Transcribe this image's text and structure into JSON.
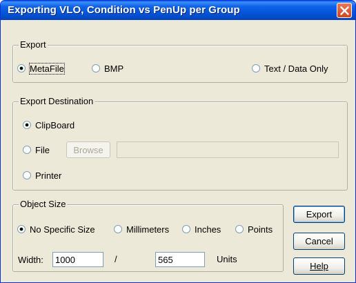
{
  "window": {
    "title": "Exporting VLO, Condition vs PenUp per Group"
  },
  "export": {
    "legend": "Export",
    "options": [
      {
        "label": "MetaFile",
        "checked": true
      },
      {
        "label": "BMP",
        "checked": false
      },
      {
        "label": "Text / Data Only",
        "checked": false
      }
    ]
  },
  "destination": {
    "legend": "Export Destination",
    "clipboard": {
      "label": "ClipBoard",
      "checked": true
    },
    "file": {
      "label": "File",
      "checked": false
    },
    "browse_label": "Browse",
    "file_path": "",
    "printer": {
      "label": "Printer",
      "checked": false
    }
  },
  "object_size": {
    "legend": "Object Size",
    "options": [
      {
        "label": "No Specific Size",
        "checked": true
      },
      {
        "label": "Millimeters",
        "checked": false
      },
      {
        "label": "Inches",
        "checked": false
      },
      {
        "label": "Points",
        "checked": false
      }
    ],
    "width_label": "Width:",
    "width_value": "1000",
    "separator": "/",
    "height_value": "565",
    "units_label": "Units"
  },
  "buttons": {
    "export": "Export",
    "cancel": "Cancel",
    "help": "Help"
  }
}
